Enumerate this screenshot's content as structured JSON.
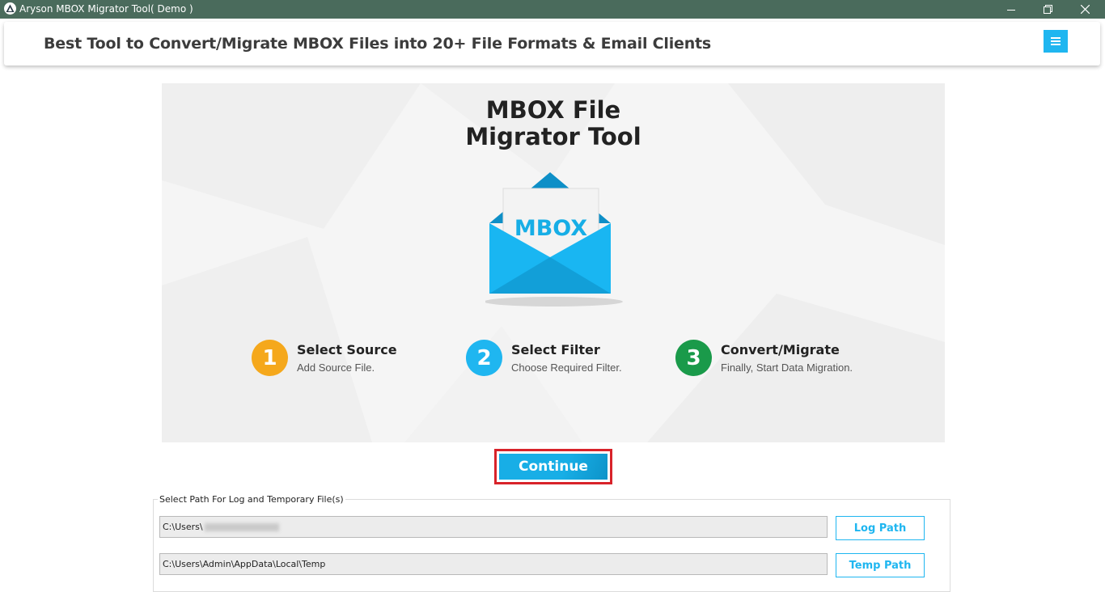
{
  "window": {
    "title": "Aryson MBOX Migrator Tool( Demo )",
    "controls": [
      "minimize-icon",
      "restore-icon",
      "close-icon"
    ]
  },
  "header": {
    "headline": "Best Tool to Convert/Migrate MBOX Files into 20+ File Formats & Email Clients",
    "menu_icon": "hamburger-menu-icon"
  },
  "hero": {
    "title_line1": "MBOX File",
    "title_line2": "Migrator Tool",
    "envelope_label": "MBOX",
    "steps": [
      {
        "number": "1",
        "title": "Select Source",
        "subtitle": "Add Source File.",
        "color": "#f5a81c"
      },
      {
        "number": "2",
        "title": "Select Filter",
        "subtitle": "Choose Required Filter.",
        "color": "#1fb6f0"
      },
      {
        "number": "3",
        "title": "Convert/Migrate",
        "subtitle": "Finally, Start Data Migration.",
        "color": "#1a9a4a"
      }
    ]
  },
  "continue_label": "Continue",
  "paths": {
    "group_label": "Select Path For Log and Temporary File(s)",
    "log_path_value": "C:\\Users\\",
    "log_path_button": "Log Path",
    "temp_path_value": "C:\\Users\\Admin\\AppData\\Local\\Temp",
    "temp_path_button": "Temp Path"
  },
  "colors": {
    "titlebar": "#4a6b5c",
    "accent": "#1fb6f0",
    "highlight_border": "#d8232a"
  }
}
